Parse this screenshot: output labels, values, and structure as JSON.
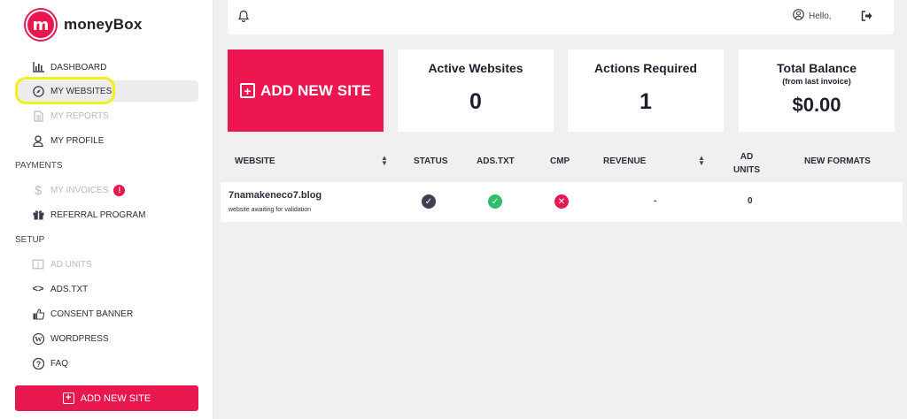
{
  "brand": {
    "name_prefix": "money",
    "name_suffix": "Box",
    "mark": "m",
    "color": "#e8184f"
  },
  "sidebar": {
    "items": [
      {
        "label": "DASHBOARD",
        "icon": "bar-chart-icon"
      },
      {
        "label": "MY WEBSITES",
        "icon": "compass-icon"
      },
      {
        "label": "MY REPORTS",
        "icon": "document-icon"
      },
      {
        "label": "MY PROFILE",
        "icon": "user-icon"
      }
    ],
    "payments_label": "PAYMENTS",
    "payments_items": [
      {
        "label": "MY INVOICES",
        "icon": "dollar-icon",
        "badge": "!"
      },
      {
        "label": "REFERRAL PROGRAM",
        "icon": "gift-icon"
      }
    ],
    "setup_label": "SETUP",
    "setup_items": [
      {
        "label": "AD UNITS",
        "icon": "layout-icon"
      },
      {
        "label": "ADS.TXT",
        "icon": "code-icon"
      },
      {
        "label": "CONSENT BANNER",
        "icon": "thumbs-up-icon"
      },
      {
        "label": "WORDPRESS",
        "icon": "wordpress-icon"
      },
      {
        "label": "FAQ",
        "icon": "question-icon"
      }
    ],
    "add_button": "ADD NEW SITE"
  },
  "topbar": {
    "hello": "Hello,"
  },
  "cards": {
    "add_new": "ADD NEW SITE",
    "active_title": "Active Websites",
    "active_value": "0",
    "actions_title": "Actions Required",
    "actions_value": "1",
    "balance_title": "Total Balance",
    "balance_sub": "(from last invoice)",
    "balance_value": "$0.00"
  },
  "table": {
    "headers": {
      "website": "WEBSITE",
      "status": "STATUS",
      "adstxt": "ADS.TXT",
      "cmp": "CMP",
      "revenue": "REVENUE",
      "ad_units_1": "AD",
      "ad_units_2": "UNITS",
      "new_formats": "NEW FORMATS"
    },
    "rows": [
      {
        "site": "7namakeneco7.blog",
        "note": "website awaiting for validation",
        "revenue": "-",
        "ad_units": "0"
      }
    ]
  },
  "colors": {
    "accent": "#ed1651",
    "ok": "#2ebd6b",
    "error": "#e8184f",
    "neutral": "#3a3a4a"
  }
}
